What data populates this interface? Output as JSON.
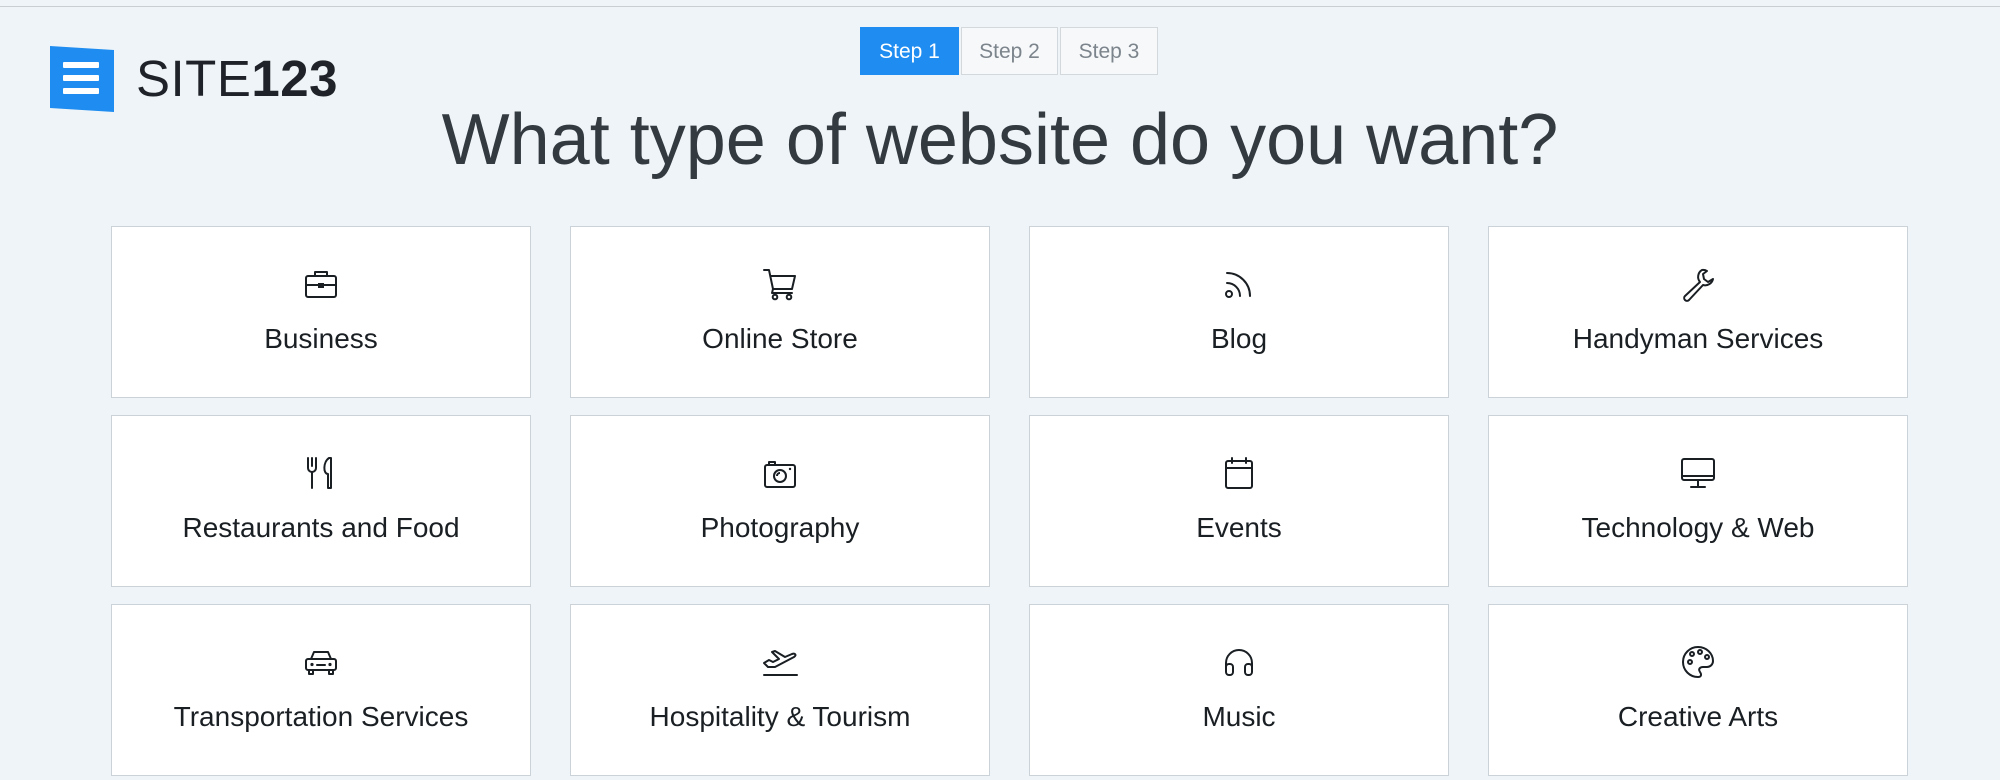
{
  "brand": {
    "name_light": "SITE",
    "name_bold": "123",
    "color": "#1e8cf0"
  },
  "steps": [
    {
      "label": "Step 1",
      "active": true
    },
    {
      "label": "Step 2",
      "active": false
    },
    {
      "label": "Step 3",
      "active": false
    }
  ],
  "headline": "What type of website do you want?",
  "categories": [
    {
      "label": "Business",
      "icon": "briefcase-icon"
    },
    {
      "label": "Online Store",
      "icon": "shopping-cart-icon"
    },
    {
      "label": "Blog",
      "icon": "rss-icon"
    },
    {
      "label": "Handyman Services",
      "icon": "wrench-icon"
    },
    {
      "label": "Restaurants and Food",
      "icon": "fork-knife-icon"
    },
    {
      "label": "Photography",
      "icon": "camera-icon"
    },
    {
      "label": "Events",
      "icon": "calendar-icon"
    },
    {
      "label": "Technology & Web",
      "icon": "monitor-icon"
    },
    {
      "label": "Transportation Services",
      "icon": "car-icon"
    },
    {
      "label": "Hospitality & Tourism",
      "icon": "airplane-icon"
    },
    {
      "label": "Music",
      "icon": "headphones-icon"
    },
    {
      "label": "Creative Arts",
      "icon": "palette-icon"
    }
  ],
  "colors": {
    "accent": "#1e8cf0",
    "background": "#eef4f8",
    "card": "#ffffff",
    "text": "#1a1f24"
  }
}
